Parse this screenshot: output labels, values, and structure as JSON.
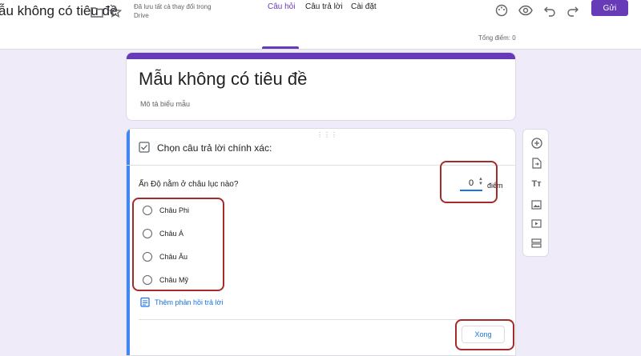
{
  "header": {
    "doc_title": "ẫu không có tiêu đề",
    "save_status": "Đã lưu tất cả thay đổi trong Drive",
    "send_label": "Gửi",
    "icons": [
      "folder-icon",
      "star-icon",
      "palette-icon",
      "preview-icon",
      "undo-icon",
      "redo-icon"
    ],
    "accent_color": "#673ab7"
  },
  "tabs": {
    "items": [
      {
        "label": "Câu hỏi"
      },
      {
        "label": "Câu trả lời"
      },
      {
        "label": "Cài đặt"
      }
    ],
    "active": "Câu hỏi",
    "total_points": "Tổng điểm: 0"
  },
  "form": {
    "title": "Mẫu không có tiêu đề",
    "description": "Mô tả biểu mẫu"
  },
  "question": {
    "answer_key_label": "Chọn câu trả lời chính xác:",
    "text": "Ấn Độ nằm ở châu lục nào?",
    "points_value": "0",
    "points_label": "điểm",
    "options": [
      "Châu Phi",
      "Châu Á",
      "Châu Âu",
      "Châu Mỹ"
    ],
    "feedback_label": "Thêm phản hồi trả lời",
    "done_label": "Xong"
  },
  "side_toolbar": {
    "icons": [
      "add-question-icon",
      "import-question-icon",
      "add-title-icon",
      "add-image-icon",
      "add-video-icon",
      "add-section-icon"
    ]
  }
}
